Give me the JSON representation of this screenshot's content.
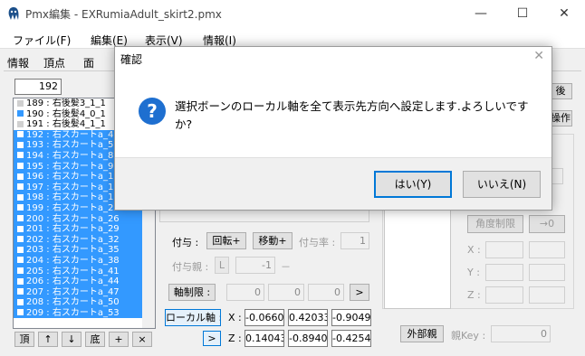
{
  "window": {
    "title": "Pmx編集 - EXRumiaAdult_skirt2.pmx",
    "minimize": "—",
    "maximize": "☐",
    "close": "✕"
  },
  "menu": [
    "ファイル(F)",
    "編集(E)",
    "表示(V)",
    "情報(I)"
  ],
  "tabs": [
    "情報",
    "頂点",
    "面"
  ],
  "bone_list": {
    "index_value": "192",
    "items": [
      {
        "label": "189 : 右後髪3_1_1",
        "selected": false
      },
      {
        "label": "190 : 右後髪4_0_1",
        "selected": false
      },
      {
        "label": "191 : 右後髪4_1_1",
        "selected": false
      },
      {
        "label": "192 : 右スカートa_4",
        "selected": true
      },
      {
        "label": "193 : 右スカートa_5",
        "selected": true
      },
      {
        "label": "194 : 右スカートa_8",
        "selected": true
      },
      {
        "label": "195 : 右スカートa_9",
        "selected": true
      },
      {
        "label": "196 : 右スカートa_1",
        "selected": true
      },
      {
        "label": "197 : 右スカートa_1",
        "selected": true
      },
      {
        "label": "198 : 右スカートa_1",
        "selected": true
      },
      {
        "label": "199 : 右スカートa_23",
        "selected": true
      },
      {
        "label": "200 : 右スカートa_26",
        "selected": true
      },
      {
        "label": "201 : 右スカートa_29",
        "selected": true
      },
      {
        "label": "202 : 右スカートa_32",
        "selected": true
      },
      {
        "label": "203 : 右スカートa_35",
        "selected": true
      },
      {
        "label": "204 : 右スカートa_38",
        "selected": true
      },
      {
        "label": "205 : 右スカートa_41",
        "selected": true
      },
      {
        "label": "206 : 右スカートa_44",
        "selected": true
      },
      {
        "label": "207 : 右スカートa_47",
        "selected": true
      },
      {
        "label": "208 : 右スカートa_50",
        "selected": true
      },
      {
        "label": "209 : 右スカートa_53",
        "selected": true
      }
    ],
    "buttons": [
      "頂",
      "↑",
      "↓",
      "底",
      "+",
      "×"
    ]
  },
  "grant": {
    "label": "付与 :",
    "rotate": "回転+",
    "move": "移動+",
    "rate_label": "付与率 :",
    "rate_value": "1",
    "parent_label": "付与親 :",
    "parent_btn": "L",
    "parent_value": "-1",
    "parent_dash": "－"
  },
  "axis_limit": {
    "button": "軸制限 :",
    "values": [
      "0",
      "0",
      "0"
    ],
    "arrow": ">"
  },
  "local_axis": {
    "button": "ローカル軸 :",
    "arrow": ">",
    "x_label": "X :",
    "x_values": [
      "-0.0660",
      "0.42033",
      "-0.9049"
    ],
    "z_label": "Z :",
    "z_values": [
      "0.14043",
      "-0.8940",
      "-0.4254"
    ]
  },
  "right_panel": {
    "after_btn": "後",
    "ops_btn": "操作",
    "angle_limit": "角度制限",
    "arrow_zero": "→0",
    "x": "X :",
    "y": "Y :",
    "z": "Z :",
    "external_parent": "外部親",
    "parent_key_label": "親Key :",
    "parent_key_value": "0"
  },
  "dialog": {
    "title": "確認",
    "close": "✕",
    "icon": "?",
    "message": "選択ボーンのローカル軸を全て表示先方向へ設定します.よろしいですか?",
    "yes": "はい(Y)",
    "no": "いいえ(N)"
  },
  "colors": {
    "accent": "#0078d7",
    "selection": "#3399ff",
    "info_icon": "#1e6fd0"
  }
}
